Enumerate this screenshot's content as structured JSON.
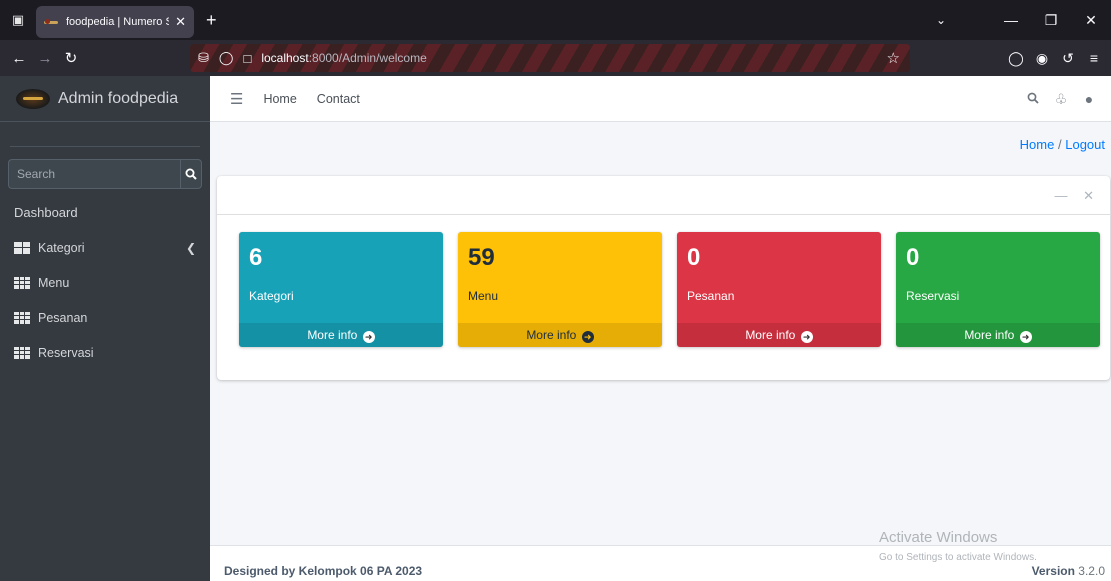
{
  "browser": {
    "tab_title": "foodpedia | Numero Sada",
    "url_host": "localhost",
    "url_path": ":8000/Admin/welcome"
  },
  "sidebar": {
    "brand": "Admin foodpedia",
    "search_placeholder": "Search",
    "heading": "Dashboard",
    "items": [
      {
        "label": "Kategori",
        "icon": "table-icon"
      },
      {
        "label": "Menu",
        "icon": "grid-icon"
      },
      {
        "label": "Pesanan",
        "icon": "grid-icon"
      },
      {
        "label": "Reservasi",
        "icon": "grid-icon"
      }
    ]
  },
  "header": {
    "links": [
      "Home",
      "Contact"
    ]
  },
  "breadcrumb": {
    "home": "Home",
    "separator": "/",
    "logout": "Logout"
  },
  "stats": [
    {
      "value": "6",
      "label": "Kategori",
      "footer": "More info",
      "color": "#17a2b8"
    },
    {
      "value": "59",
      "label": "Menu",
      "footer": "More info",
      "color": "#ffc107"
    },
    {
      "value": "0",
      "label": "Pesanan",
      "footer": "More info",
      "color": "#dc3545"
    },
    {
      "value": "0",
      "label": "Reservasi",
      "footer": "More info",
      "color": "#28a745"
    }
  ],
  "footer": {
    "credit": "Designed by Kelompok 06 PA 2023",
    "version_label": "Version",
    "version_number": "3.2.0"
  },
  "watermark": {
    "title": "Activate Windows",
    "subtitle": "Go to Settings to activate Windows."
  }
}
